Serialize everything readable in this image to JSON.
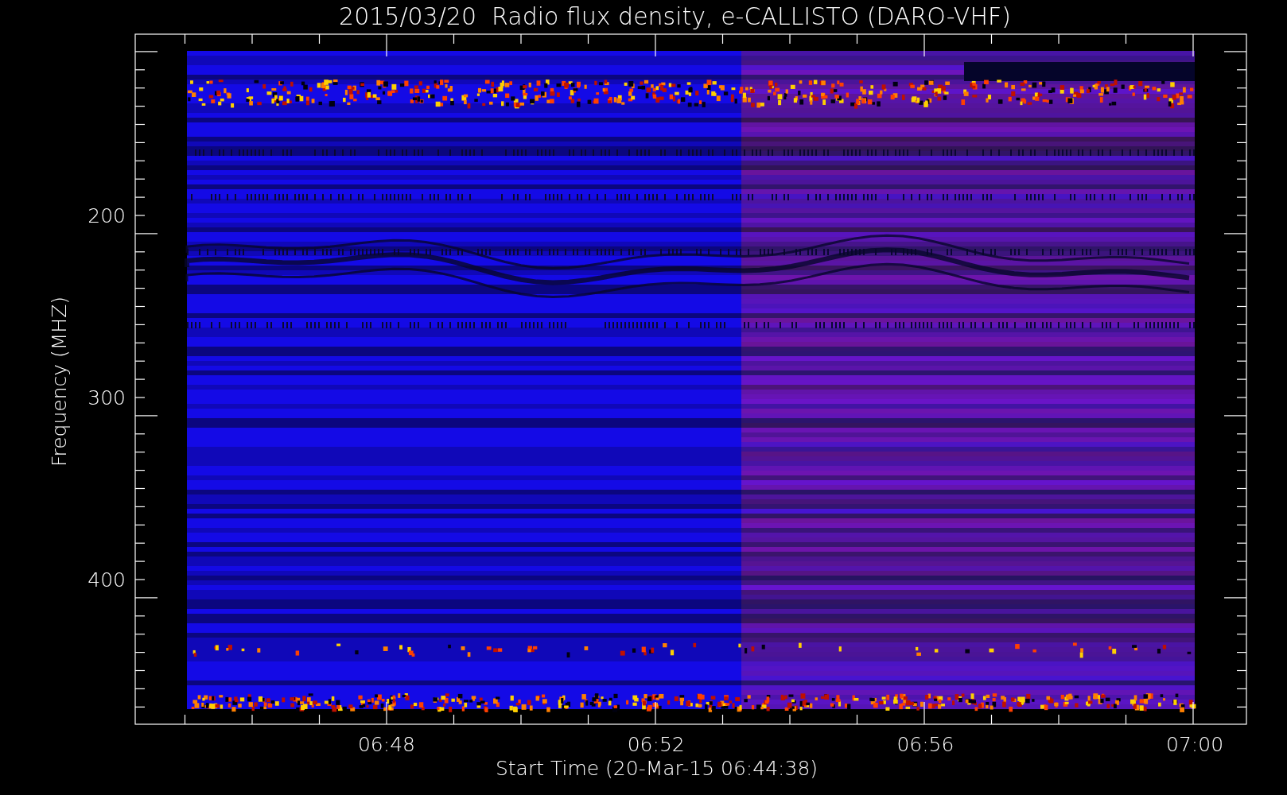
{
  "title": "2015/03/20  Radio flux density, e-CALLISTO (DARO-VHF)",
  "plot": {
    "ylabel": "Frequency (MHZ)",
    "xlabel": "Start Time (20-Mar-15 06:44:38)",
    "yticks": [
      "200",
      "300",
      "400"
    ],
    "xticks": [
      "06:48",
      "06:52",
      "06:56",
      "07:00"
    ]
  }
}
